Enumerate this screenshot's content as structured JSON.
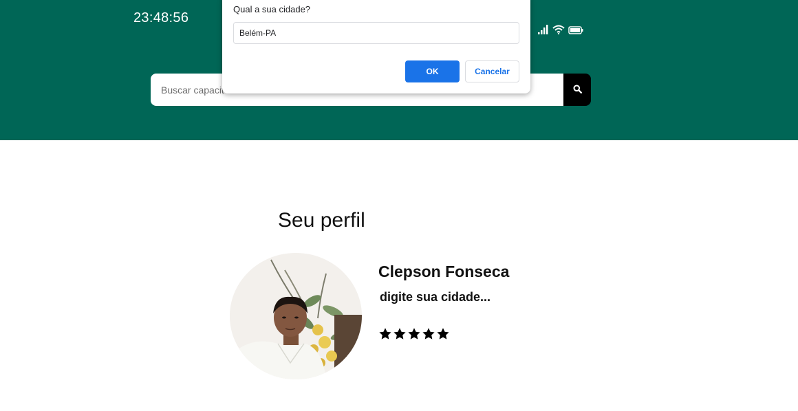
{
  "clock": {
    "time": "23:48:56"
  },
  "status_bar": {
    "icons": [
      "signal-icon",
      "wifi-icon",
      "battery-icon"
    ],
    "color": "#ffffff"
  },
  "header": {
    "background": "#006656"
  },
  "search": {
    "placeholder": "Buscar capacit",
    "button_icon": "search-icon"
  },
  "dialog": {
    "message": "Qual a sua cidade?",
    "input_value": "Belém-PA",
    "ok_label": "OK",
    "cancel_label": "Cancelar",
    "accent": "#1a73e8"
  },
  "profile": {
    "section_title": "Seu perfil",
    "name": "Clepson Fonseca",
    "city": "digite sua cidade...",
    "rating": {
      "value": 5,
      "max": 5,
      "icon": "star-icon"
    }
  }
}
